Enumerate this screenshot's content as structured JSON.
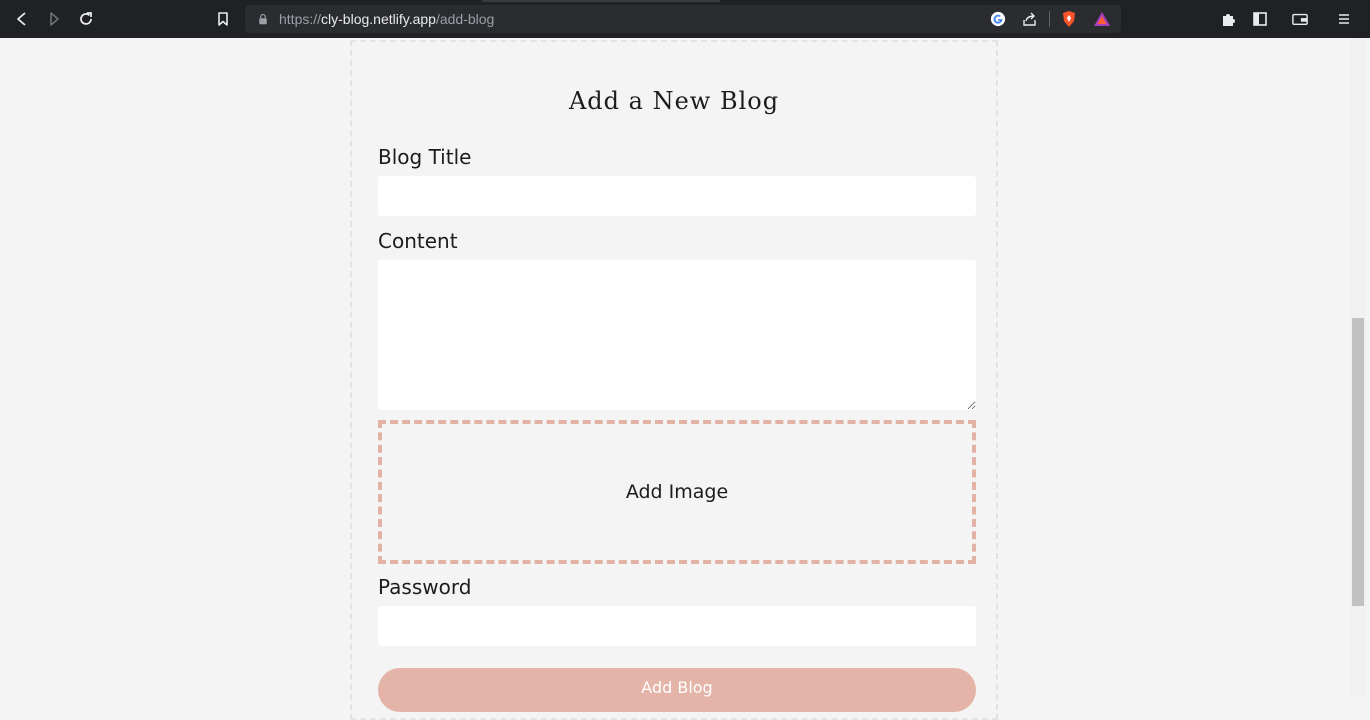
{
  "browser": {
    "url_scheme": "https://",
    "url_host": "cly-blog.netlify.app",
    "url_path": "/add-blog",
    "icons": [
      "back-icon",
      "forward-icon",
      "reload-icon",
      "bookmark-icon",
      "lock-icon",
      "google-icon",
      "share-icon",
      "brave-shields-icon",
      "brave-rewards-icon",
      "extensions-icon",
      "sidebar-icon",
      "wallet-icon",
      "menu-icon"
    ]
  },
  "form": {
    "heading": "Add a New Blog",
    "title_label": "Blog Title",
    "title_value": "",
    "content_label": "Content",
    "content_value": "",
    "image_label": "Add Image",
    "password_label": "Password",
    "password_value": "",
    "submit_label": "Add Blog"
  },
  "colors": {
    "accent": "#e4b4a8",
    "dashed_accent": "#e2b2a5",
    "page_bg": "#f4f4f4"
  }
}
